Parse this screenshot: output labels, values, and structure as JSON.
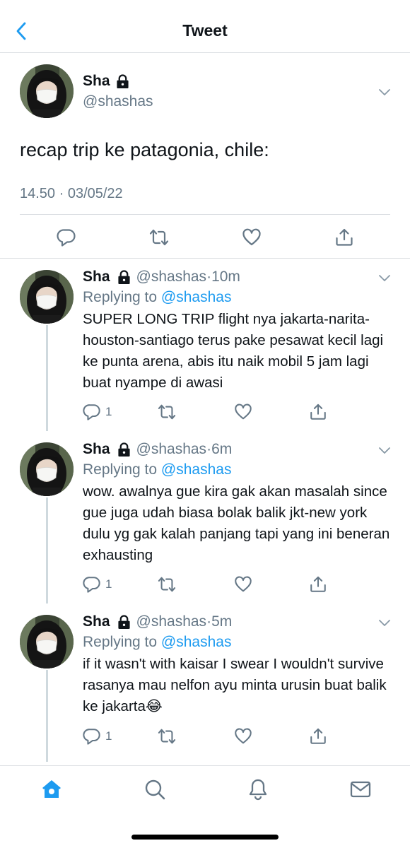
{
  "header": {
    "title": "Tweet"
  },
  "main_tweet": {
    "name": "Sha",
    "handle": "@shashas",
    "text": "recap trip ke patagonia, chile:",
    "timestamp": "14.50 · 03/05/22"
  },
  "replies": [
    {
      "name": "Sha",
      "handle": "@shashas",
      "dot": "·",
      "time": "10m",
      "replying_prefix": "Replying to",
      "replying_to": "@shashas",
      "text": "SUPER LONG TRIP flight nya jakarta-narita-houston-santiago terus pake pesawat kecil lagi ke punta arena, abis itu naik mobil 5 jam lagi buat nyampe di awasi",
      "reply_count": "1"
    },
    {
      "name": "Sha",
      "handle": "@shashas",
      "dot": "·",
      "time": "6m",
      "replying_prefix": "Replying to",
      "replying_to": "@shashas",
      "text": "wow. awalnya gue kira gak akan masalah since gue juga udah biasa bolak balik jkt-new york dulu yg gak kalah panjang tapi yang ini beneran exhausting",
      "reply_count": "1"
    },
    {
      "name": "Sha",
      "handle": "@shashas",
      "dot": "·",
      "time": "5m",
      "replying_prefix": "Replying to",
      "replying_to": "@shashas",
      "text": "if it wasn't with kaisar I swear I wouldn't survive rasanya mau nelfon ayu minta urusin buat balik ke jakarta😂",
      "reply_count": "1"
    }
  ],
  "icons": {
    "back": "chevron-left-icon",
    "lock": "lock-icon",
    "caret": "chevron-down-icon",
    "reply": "comment-icon",
    "retweet": "retweet-icon",
    "like": "heart-icon",
    "share": "share-icon",
    "tabs": [
      "home-icon",
      "search-icon",
      "notifications-icon",
      "messages-icon"
    ]
  },
  "colors": {
    "accent": "#1d9bf0",
    "secondary_text": "#657786",
    "divider": "#dcdfe3"
  }
}
